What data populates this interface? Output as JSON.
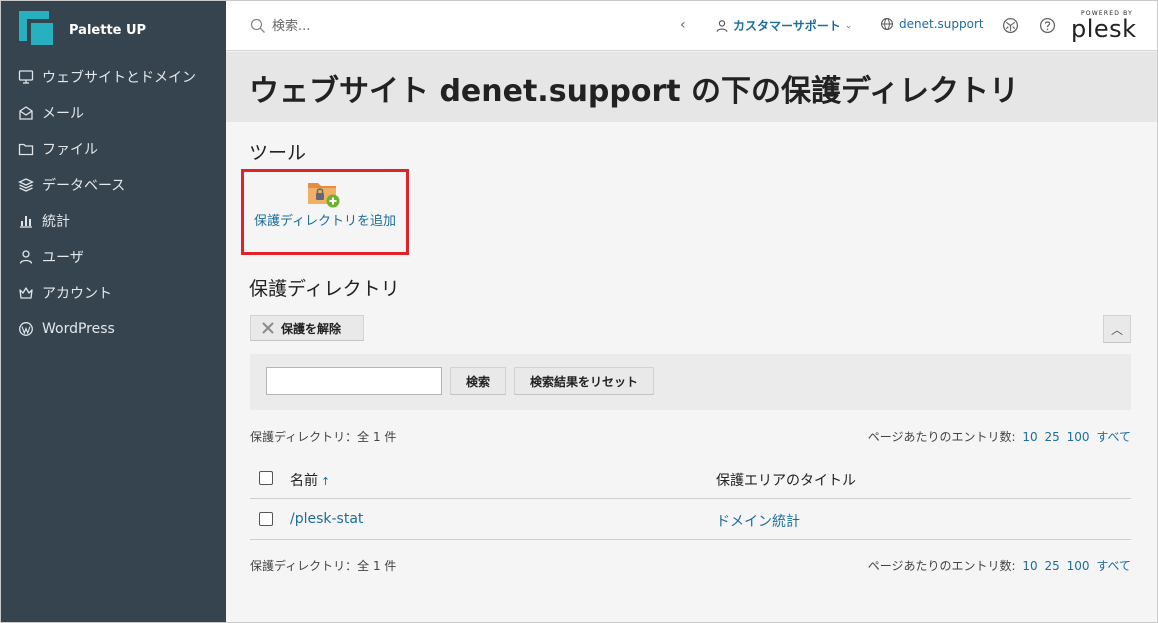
{
  "brand": {
    "name": "Palette UP"
  },
  "sidebar": {
    "items": [
      {
        "label": "ウェブサイトとドメイン",
        "icon": "monitor-icon"
      },
      {
        "label": "メール",
        "icon": "mail-icon"
      },
      {
        "label": "ファイル",
        "icon": "folder-icon"
      },
      {
        "label": "データベース",
        "icon": "database-layers-icon"
      },
      {
        "label": "統計",
        "icon": "bar-chart-icon"
      },
      {
        "label": "ユーザ",
        "icon": "user-icon"
      },
      {
        "label": "アカウント",
        "icon": "crown-icon"
      },
      {
        "label": "WordPress",
        "icon": "wordpress-icon"
      }
    ]
  },
  "topbar": {
    "search_placeholder": "検索...",
    "back_glyph": "‹",
    "support_label": "カスタマーサポート",
    "support_chevron": "⌄",
    "domain_label": "denet.support",
    "powered_by": "POWERED BY",
    "plesk": "plesk"
  },
  "page": {
    "title": "ウェブサイト denet.support の下の保護ディレクトリ"
  },
  "tools": {
    "title": "ツール",
    "add_label": "保護ディレクトリを追加"
  },
  "directories": {
    "title": "保護ディレクトリ",
    "unprotect_label": "保護を解除",
    "collapse_glyph": "︿",
    "search_value": "",
    "search_button": "検索",
    "reset_button": "検索結果をリセット",
    "summary": "保護ディレクトリ：全 1 件",
    "per_page_label": "ページあたりのエントリ数:",
    "per_page_options": [
      "10",
      "25",
      "100",
      "すべて"
    ],
    "columns": {
      "name": "名前",
      "sort_glyph": "↑",
      "title": "保護エリアのタイトル"
    },
    "rows": [
      {
        "name": "/plesk-stat",
        "title": "ドメイン統計"
      }
    ]
  },
  "colors": {
    "sidebar_bg": "#36444f",
    "brand_accent": "#27b1c0",
    "link": "#1d6d9c",
    "highlight_frame": "#e0232a"
  }
}
